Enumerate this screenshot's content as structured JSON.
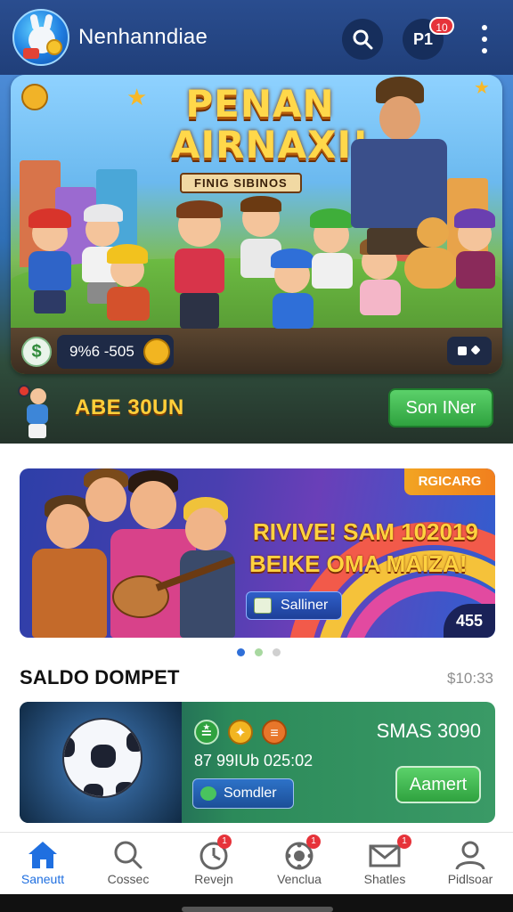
{
  "header": {
    "title": "Nenhanndiae",
    "profile_label": "P1",
    "notification_count": "10"
  },
  "hero": {
    "title_line1": "PENAN",
    "title_line2": "AIRNAXI!",
    "subtitle": "FINIG SIBINOS",
    "dollar_icon": "$",
    "code": "9%6 -505",
    "bottom_text": "ABE 30UN",
    "button_label": "Son INer"
  },
  "promo": {
    "tag": "RGICARG",
    "line1": "RIVIVE! SAM 102019",
    "line2": "BEIKE OMA MAIZA!",
    "button_label": "Salliner",
    "count": "455"
  },
  "carousel": {
    "total": 3,
    "active": 0
  },
  "wallet_section": {
    "title": "SALDO DOMPET",
    "time": "$10:33"
  },
  "wallet": {
    "title": "SMAS 3090",
    "subtitle": "87 99IUb 025:02",
    "button_left": "Somdler",
    "button_right": "Aamert"
  },
  "nav": {
    "items": [
      {
        "label": "Saneutt",
        "icon": "home-icon",
        "active": true
      },
      {
        "label": "Cossec",
        "icon": "search-icon",
        "active": false
      },
      {
        "label": "Revejn",
        "icon": "clock-icon",
        "active": false,
        "badge": "1"
      },
      {
        "label": "Venclua",
        "icon": "settings-icon",
        "active": false,
        "badge": "1"
      },
      {
        "label": "Shatles",
        "icon": "mail-icon",
        "active": false,
        "badge": "1"
      },
      {
        "label": "Pidlsoar",
        "icon": "profile-icon",
        "active": false
      }
    ]
  },
  "colors": {
    "header_bg": "#2a4d8f",
    "accent_green": "#2fa23f",
    "nav_active": "#1f6fe0",
    "badge_red": "#e6333a",
    "promo_text": "#ffd23f"
  }
}
